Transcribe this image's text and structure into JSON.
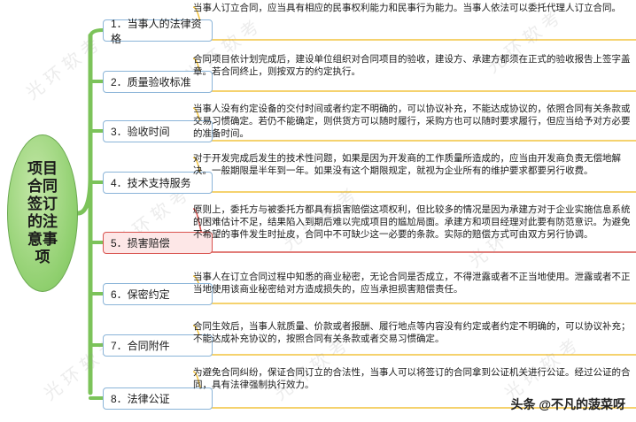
{
  "root": {
    "label": "项目合同签订的注意事项"
  },
  "branches": [
    {
      "label": "1．当事人的法律资格",
      "color": "#f2c33f",
      "fill": "#ffffff",
      "text": "当事人订立合同，应当具有相应的民事权利能力和民事行为能力。当事人依法可以委托代理人订立合同。"
    },
    {
      "label": "2．质量验收标准",
      "color": "#f2c33f",
      "fill": "#ffffff",
      "text": "合同项目依计划完成后，建设单位组织对合同项目的验收，建设方、承建方都须在正式的验收报告上签字盖章。若合同终止，则按双方的约定执行。"
    },
    {
      "label": "3．验收时间",
      "color": "#f2c33f",
      "fill": "#ffffff",
      "text": "当事人没有约定设备的交付时间或者约定不明确的，可以协议补充，不能达成协议的，依照合同有关条款或交易习惯确定。若仍不能确定，则供货方可以随时履行，采购方也可以随时要求履行，但应当给予对方必要的准备时间。"
    },
    {
      "label": "4．技术支持服务",
      "color": "#f2c33f",
      "fill": "#ffffff",
      "text": "对于开发完成后发生的技术性问题，如果是因为开发商的工作质量所造成的，应当由开发商负责无偿地解决。一般期限是半年到一年。如果没有这个期限规定，就视为企业所有的维护要求都要另行收费。"
    },
    {
      "label": "5．损害赔偿",
      "color": "#d9534f",
      "fill": "#fde7e7",
      "text": "原则上，委托方与被委托方都具有损害赔偿这项权利，但比较多的情况是因为承建方对于企业实施信息系统的困难估计不足，结果陷入到期后难以完成项目的尴尬局面。承建方和项目经理对此要有防范意识。为避免不希望的事件发生时扯皮，合同中不可缺少这一必要的条款。实际的赔偿方式可由双方另行协调。"
    },
    {
      "label": "6．保密约定",
      "color": "#f2c33f",
      "fill": "#ffffff",
      "text": "当事人在订立合同过程中知悉的商业秘密，无论合同是否成立，不得泄露或者不正当地使用。泄露或者不正当地使用该商业秘密给对方造成损失的，应当承担损害赔偿责任。"
    },
    {
      "label": "7．合同附件",
      "color": "#f2c33f",
      "fill": "#ffffff",
      "text": "合同生效后，当事人就质量、价款或者报酬、履行地点等内容没有约定或者约定不明确的，可以协议补充；不能达成补充协议的，按照合同有关条款或者交易习惯确定。"
    },
    {
      "label": "8．法律公证",
      "color": "#f2c33f",
      "fill": "#ffffff",
      "text": "为避免合同纠纷，保证合同订立的合法性，当事人可以将签订的合同拿到公证机关进行公证。经过公证的合同，具有法律强制执行效力。"
    }
  ],
  "watermark": "光环软考",
  "signature": "头条 @不凡的菠菜呀",
  "colors": {
    "trunk": "#7cc35a",
    "node_border": "#8ab4d8"
  }
}
